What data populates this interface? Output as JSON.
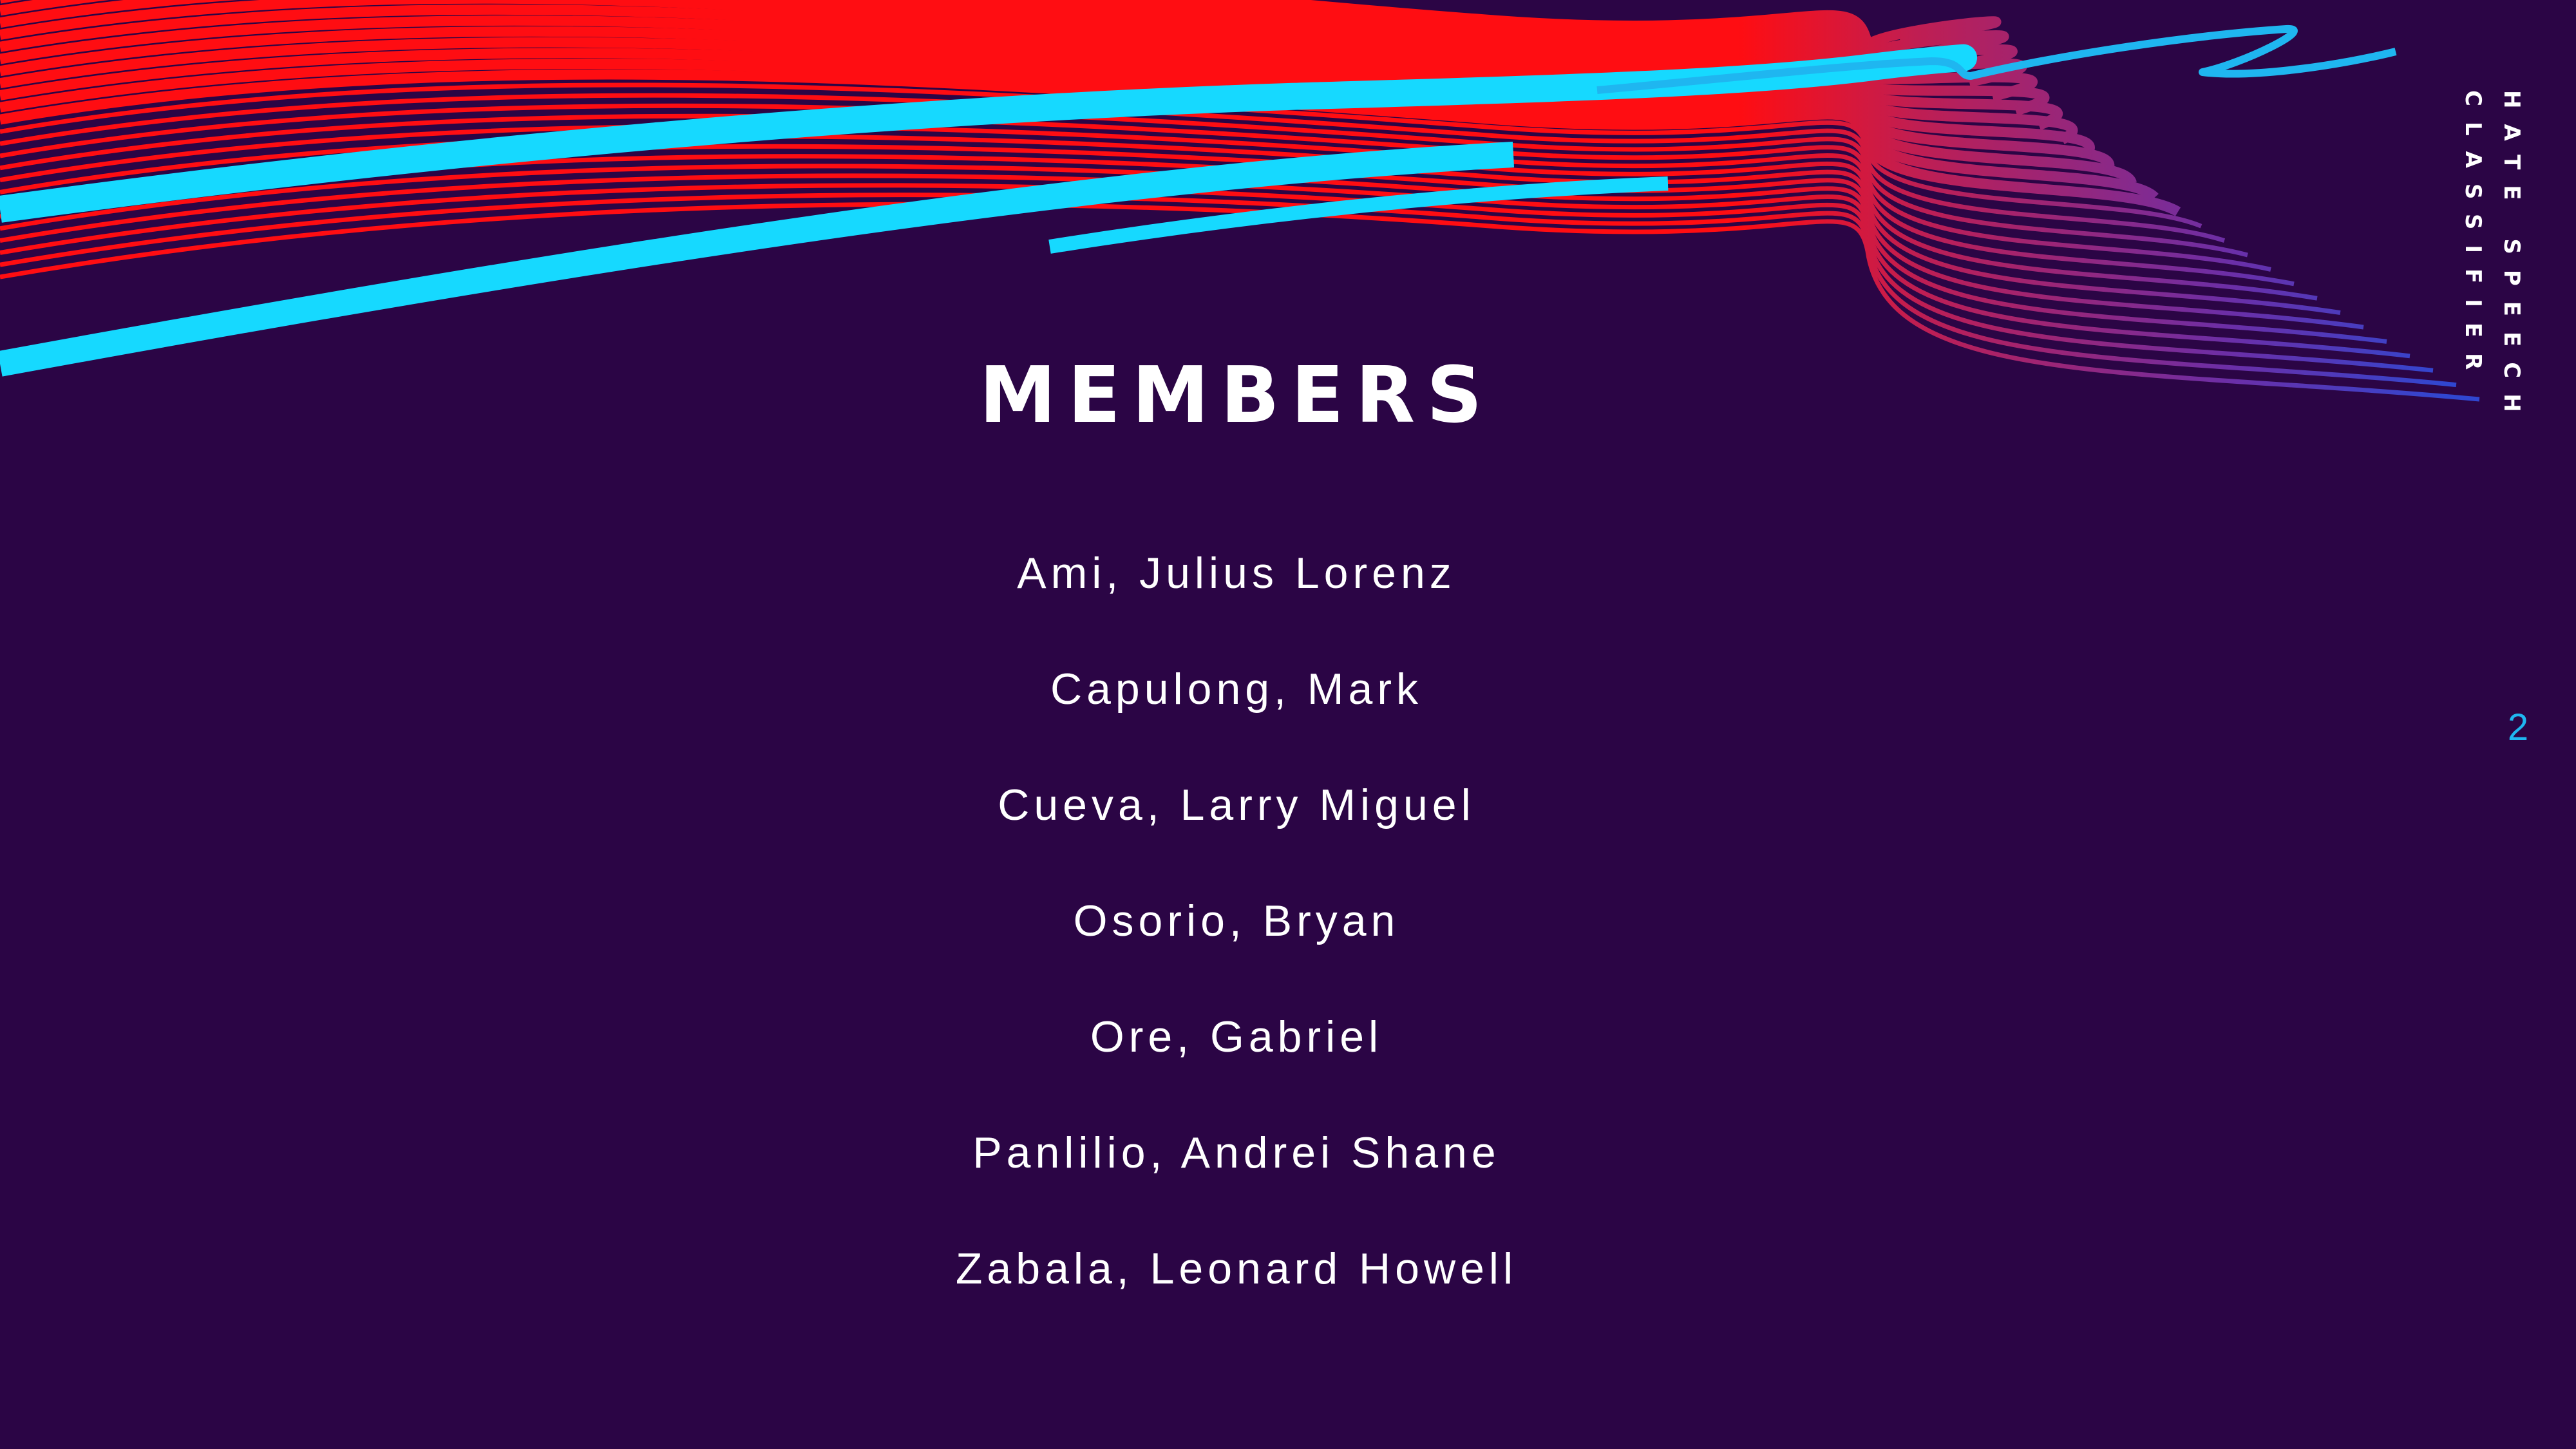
{
  "slide": {
    "title": "MEMBERS",
    "side_title": "HATE SPEECH CLASSIFIER",
    "page_number": "2",
    "members": [
      "Ami, Julius Lorenz",
      "Capulong, Mark",
      "Cueva, Larry Miguel",
      "Osorio, Bryan",
      "Ore, Gabriel",
      "Panlilio, Andrei Shane",
      "Zabala, Leonard Howell"
    ]
  },
  "colors": {
    "background": "#2b0545",
    "red_lines": "#ff0d12",
    "cyan_lines": "#16d9ff",
    "wave_fade_start": "#c01e52",
    "wave_fade_end": "#3047d0",
    "page_number": "#1fb6f0",
    "text": "#ffffff"
  }
}
